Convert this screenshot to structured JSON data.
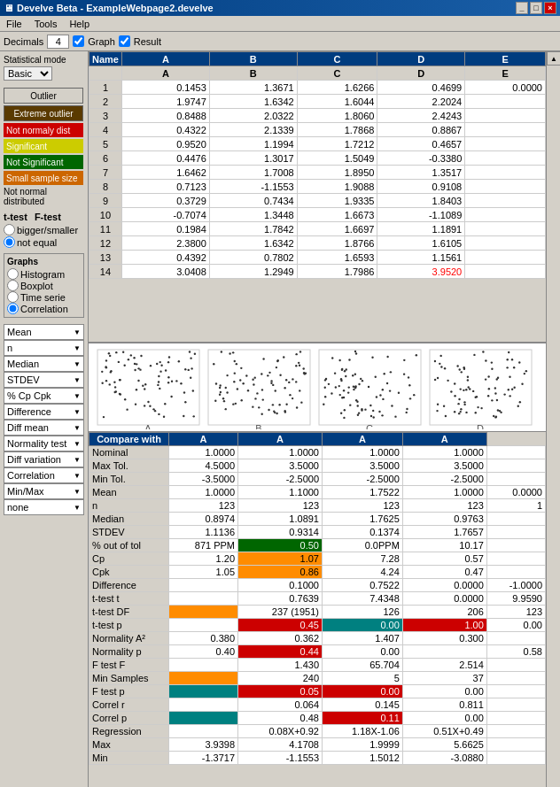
{
  "titleBar": {
    "title": "Develve Beta - ExampleWebpage2.develve",
    "buttons": [
      "_",
      "□",
      "×"
    ]
  },
  "menuBar": {
    "items": [
      "File",
      "Tools",
      "Help"
    ]
  },
  "toolbar": {
    "decimalsLabel": "Decimals",
    "decimalsValue": "4",
    "graphLabel": "Graph",
    "resultLabel": "Result"
  },
  "leftPanel": {
    "statModeLabel": "Statistical mode",
    "statModeValue": "Basic",
    "btnOutlier": "Outlier",
    "btnExtreme": "Extreme outlier",
    "legendItems": [
      {
        "label": "Not normaly dist",
        "color": "red"
      },
      {
        "label": "Significant",
        "color": "yellow"
      },
      {
        "label": "Not Significant",
        "color": "green"
      },
      {
        "label": "Small sample size",
        "color": "orange"
      }
    ],
    "notNormalLabel": "Not normal distributed",
    "ttestLabel": "t-test",
    "ftestLabel": "F-test",
    "radioOptions": [
      "bigger/smaller",
      "not equal"
    ],
    "graphsLabel": "Graphs",
    "graphOptions": [
      "Histogram",
      "Boxplot",
      "Time serie",
      "Correlation"
    ],
    "dropdowns": [
      {
        "label": "Mean",
        "value": ""
      },
      {
        "label": "n",
        "value": ""
      },
      {
        "label": "Median",
        "value": ""
      },
      {
        "label": "STDEV",
        "value": ""
      },
      {
        "label": "% Cp Cpk",
        "value": ""
      },
      {
        "label": "Difference",
        "value": ""
      },
      {
        "label": "Diff mean",
        "value": ""
      },
      {
        "label": "Normality test",
        "value": ""
      },
      {
        "label": "Diff variation",
        "value": ""
      },
      {
        "label": "Correlation",
        "value": ""
      },
      {
        "label": "Min/Max",
        "value": ""
      },
      {
        "label": "none",
        "value": ""
      }
    ]
  },
  "dataTable": {
    "headers": [
      "Name",
      "A",
      "B",
      "C",
      "D",
      "E"
    ],
    "subHeaders": [
      "",
      "A",
      "B",
      "C",
      "D",
      "E"
    ],
    "rows": [
      {
        "num": "1",
        "A": "0.1453",
        "B": "1.3671",
        "C": "1.6266",
        "D": "0.4699",
        "E": "0.0000"
      },
      {
        "num": "2",
        "A": "1.9747",
        "B": "1.6342",
        "C": "1.6044",
        "D": "2.2024",
        "E": ""
      },
      {
        "num": "3",
        "A": "0.8488",
        "B": "2.0322",
        "C": "1.8060",
        "D": "2.4243",
        "E": ""
      },
      {
        "num": "4",
        "A": "0.4322",
        "B": "2.1339",
        "C": "1.7868",
        "D": "0.8867",
        "E": ""
      },
      {
        "num": "5",
        "A": "0.9520",
        "B": "1.1994",
        "C": "1.7212",
        "D": "0.4657",
        "E": ""
      },
      {
        "num": "6",
        "A": "0.4476",
        "B": "1.3017",
        "C": "1.5049",
        "D": "-0.3380",
        "E": ""
      },
      {
        "num": "7",
        "A": "1.6462",
        "B": "1.7008",
        "C": "1.8950",
        "D": "1.3517",
        "E": ""
      },
      {
        "num": "8",
        "A": "0.7123",
        "B": "-1.1553",
        "C": "1.9088",
        "D": "0.9108",
        "E": ""
      },
      {
        "num": "9",
        "A": "0.3729",
        "B": "0.7434",
        "C": "1.9335",
        "D": "1.8403",
        "E": ""
      },
      {
        "num": "10",
        "A": "-0.7074",
        "B": "1.3448",
        "C": "1.6673",
        "D": "-1.1089",
        "E": ""
      },
      {
        "num": "11",
        "A": "0.1984",
        "B": "1.7842",
        "C": "1.6697",
        "D": "1.1891",
        "E": ""
      },
      {
        "num": "12",
        "A": "2.3800",
        "B": "1.6342",
        "C": "1.8766",
        "D": "1.6105",
        "E": ""
      },
      {
        "num": "13",
        "A": "0.4392",
        "B": "0.7802",
        "C": "1.6593",
        "D": "1.1561",
        "E": ""
      },
      {
        "num": "14",
        "A": "3.0408",
        "B": "1.2949",
        "C": "1.7986",
        "D": "3.9520",
        "E": "",
        "Dred": true
      }
    ]
  },
  "statsTable": {
    "headers": [
      "Compare with",
      "A",
      "A",
      "A",
      "A"
    ],
    "rows": [
      {
        "label": "Nominal",
        "vals": [
          "1.0000",
          "1.0000",
          "1.0000",
          "1.0000",
          ""
        ]
      },
      {
        "label": "Max Tol.",
        "vals": [
          "4.5000",
          "3.5000",
          "3.5000",
          "3.5000",
          ""
        ]
      },
      {
        "label": "Min Tol.",
        "vals": [
          "-3.5000",
          "-2.5000",
          "-2.5000",
          "-2.5000",
          ""
        ]
      },
      {
        "label": "Mean",
        "vals": [
          "1.0000",
          "1.1000",
          "1.7522",
          "1.0000",
          "0.0000"
        ]
      },
      {
        "label": "n",
        "vals": [
          "123",
          "123",
          "123",
          "123",
          "1"
        ]
      },
      {
        "label": "Median",
        "vals": [
          "0.8974",
          "1.0891",
          "1.7625",
          "0.9763",
          ""
        ]
      },
      {
        "label": "STDEV",
        "vals": [
          "1.1136",
          "0.9314",
          "0.1374",
          "1.7657",
          ""
        ]
      },
      {
        "label": "% out of tol",
        "vals": [
          "871 PPM",
          "0.50",
          "0.0PPM",
          "10.17",
          ""
        ],
        "cell2color": "",
        "cell3color": "green"
      },
      {
        "label": "Cp",
        "vals": [
          "1.20",
          "1.07",
          "7.28",
          "0.57",
          ""
        ],
        "cell3color": "orange"
      },
      {
        "label": "Cpk",
        "vals": [
          "1.05",
          "0.86",
          "4.24",
          "0.47",
          ""
        ],
        "cell3color": "orange"
      },
      {
        "label": "Difference",
        "vals": [
          "",
          "0.1000",
          "0.7522",
          "0.0000",
          "-1.0000"
        ]
      },
      {
        "label": "t-test t",
        "vals": [
          "",
          "0.7639",
          "7.4348",
          "0.0000",
          "9.9590"
        ]
      },
      {
        "label": "t-test DF",
        "vals": [
          "",
          "237 (1951)",
          "126",
          "206",
          "123"
        ],
        "cell2color": "orange"
      },
      {
        "label": "t-test p",
        "vals": [
          "",
          "0.45",
          "0.00",
          "1.00",
          "0.00"
        ],
        "cell3color": "red",
        "cell4color": "teal",
        "cell5color": "red"
      },
      {
        "label": "Normality A²",
        "vals": [
          "0.380",
          "0.362",
          "1.407",
          "0.300",
          ""
        ]
      },
      {
        "label": "Normality p",
        "vals": [
          "0.40",
          "0.44",
          "0.00",
          "",
          "0.58"
        ],
        "cell3color": "red"
      },
      {
        "label": "F test F",
        "vals": [
          "",
          "1.430",
          "65.704",
          "2.514",
          ""
        ]
      },
      {
        "label": "Min Samples",
        "vals": [
          "",
          "240",
          "5",
          "37",
          ""
        ],
        "cell2color": "orange"
      },
      {
        "label": "F test p",
        "vals": [
          "",
          "0.05",
          "0.00",
          "0.00",
          ""
        ],
        "cell2color": "teal",
        "cell3color": "red",
        "cell4color": "red"
      },
      {
        "label": "Correl r",
        "vals": [
          "",
          "0.064",
          "0.145",
          "0.811",
          ""
        ]
      },
      {
        "label": "Correl p",
        "vals": [
          "",
          "0.48",
          "0.11",
          "0.00",
          ""
        ],
        "cell2color": "teal",
        "cell4color": "red"
      },
      {
        "label": "Regression",
        "vals": [
          "",
          "0.08X+0.92",
          "1.18X-1.06",
          "0.51X+0.49",
          ""
        ]
      },
      {
        "label": "Max",
        "vals": [
          "3.9398",
          "4.1708",
          "1.9999",
          "5.6625",
          ""
        ]
      },
      {
        "label": "Min",
        "vals": [
          "-1.3717",
          "-1.1553",
          "1.5012",
          "-3.0880",
          ""
        ]
      }
    ]
  }
}
